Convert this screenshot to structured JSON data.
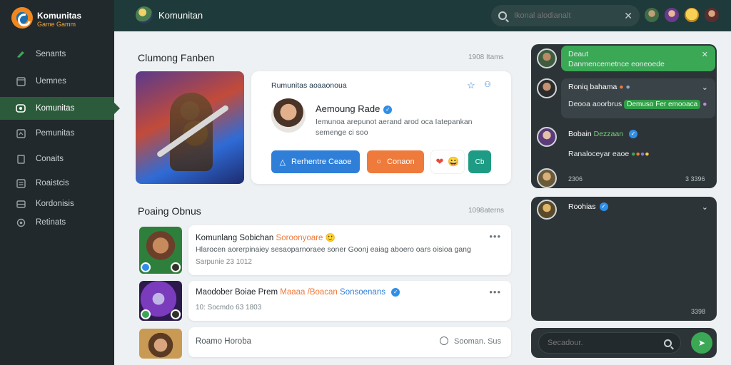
{
  "brand": {
    "title": "Komunitas",
    "subtitle": "Game Gamm"
  },
  "sidebar": {
    "items": [
      {
        "label": "Senants",
        "icon": "controller-icon"
      },
      {
        "label": "Uemnes",
        "icon": "window-icon"
      },
      {
        "label": "Komunitas",
        "icon": "community-icon",
        "active": true
      },
      {
        "label": "Pemunitas",
        "icon": "square-icon"
      },
      {
        "label": "Conaits",
        "icon": "doc-icon"
      },
      {
        "label": "Roaistcis",
        "icon": "list-icon"
      },
      {
        "label": "Kordonisis",
        "icon": "grid-icon"
      },
      {
        "label": "Retinats",
        "icon": "gear-icon"
      }
    ]
  },
  "header": {
    "title": "Komunitan",
    "search_placeholder": "Ikonal alodianalt",
    "colors": {
      "bg": "#1f3a3a"
    }
  },
  "main": {
    "featured": {
      "title": "Clumong Fanben",
      "meta": "1908 Itams"
    },
    "profile": {
      "headline": "Rumunitas aoaaonoua",
      "name": "Aemoung Rade",
      "description": "Iemunoa arepunot aerand arod oca Iatepankan semenge ci soo",
      "follow_label": "Rerhentre Ceaoe",
      "chat_label": "Conaon",
      "emoji": [
        "❤",
        "😀"
      ],
      "teal_label": "Cb"
    },
    "posts_section": {
      "title": "Poaing Obnus",
      "meta": "1098aterns"
    },
    "posts": [
      {
        "title": "Komunlang Sobichan",
        "title_tag": "Soroonyoare",
        "body": "Hlarocen aorerpinaiey sesaoparnoraee soner Goonj eaiag aboero oars oisioa gang",
        "meta": "Sarpunie 23 1012"
      },
      {
        "title": "Maodober Boiae Prem",
        "title_tag": "Maaaa /Boacan",
        "title_tag2": "Sonsoenans",
        "body": "",
        "meta": "10: Socmdo 63 1803"
      },
      {
        "title": "Roamo Horoba",
        "title_tag": "",
        "body": "",
        "meta": "Sooman. Sus"
      }
    ]
  },
  "chat": {
    "messages": [
      {
        "title": "Deaut",
        "text": "Danmencemetnce eoneoede",
        "highlight": true
      },
      {
        "title": "Roniq bahama",
        "text": "Deooa aoorbrus",
        "pill": "Demuso Fer emooaca"
      },
      {
        "title": "Bobain",
        "pill": "Dezzaan"
      },
      {
        "title": "",
        "text": "Ranaloceyar eaoe"
      }
    ],
    "time_left": "2306",
    "time_right": "3 3396",
    "second_panel": {
      "title": "Roohias",
      "time": "3398"
    },
    "input_placeholder": "Secadour."
  },
  "colors": {
    "sidebar_bg": "#22292d",
    "active_nav": "#2c5b3c",
    "accent_blue": "#2f7fd8",
    "accent_orange": "#ee7a3b",
    "accent_green": "#3ba856",
    "accent_teal": "#1e9b84"
  }
}
